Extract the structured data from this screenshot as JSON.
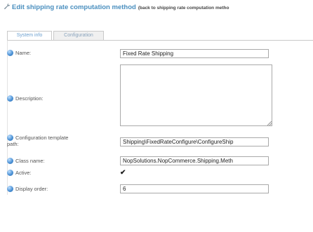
{
  "header": {
    "title": "Edit shipping rate computation method",
    "back_link": "(back to shipping rate computation metho"
  },
  "tabs": [
    {
      "label": "System info",
      "active": true
    },
    {
      "label": "Configuration",
      "active": false
    }
  ],
  "form": {
    "name_label": "Name:",
    "name_value": "Fixed Rate Shipping",
    "description_label": "Description:",
    "description_value": "",
    "config_path_label_1": "Configuration template",
    "config_path_label_2": "path:",
    "config_path_value": "Shipping\\FixedRateConfigure\\ConfigureShip",
    "class_name_label": "Class name:",
    "class_name_value": "NopSolutions.NopCommerce.Shipping.Meth",
    "active_label": "Active:",
    "active_checked": true,
    "active_mark": "✔",
    "display_order_label": "Display order:",
    "display_order_value": "6"
  },
  "colors": {
    "title": "#4a8fbf",
    "help_icon": "#4e93d6"
  },
  "icons": {
    "header": "wrench-icon",
    "help": "help-icon"
  }
}
